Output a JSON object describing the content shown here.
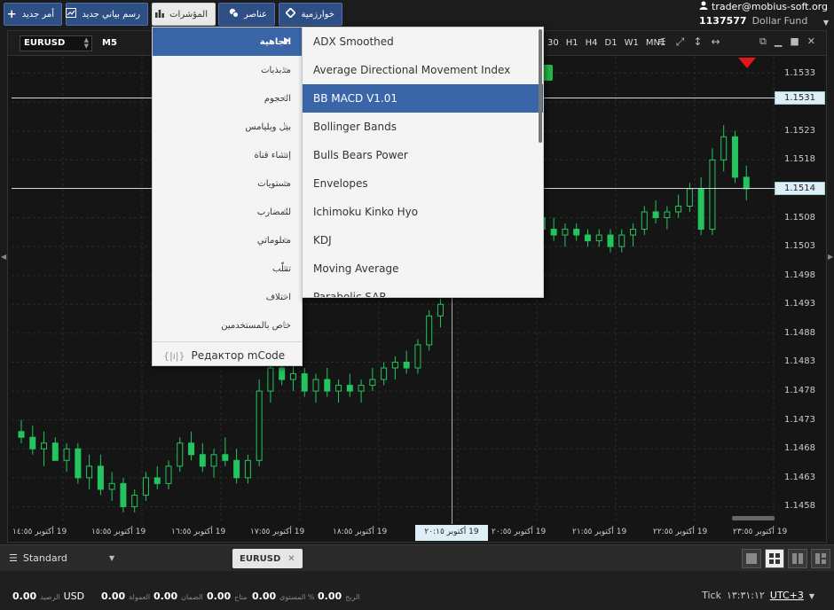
{
  "toolbar": {
    "new_order": "أمر جديد",
    "new_chart": "رسم بياني جديد",
    "indicators": "المؤشرات",
    "elements": "عناصر",
    "algorithms": "خوارزمية"
  },
  "account": {
    "email": "trader@mobius-soft.org",
    "number": "1137577",
    "name": "Dollar Fund"
  },
  "chart": {
    "symbol": "EURUSD",
    "timeframe": "M5",
    "timeframes": [
      "30",
      "H1",
      "H4",
      "D1",
      "W1",
      "MN1"
    ],
    "y_tags": [
      "1.1531",
      "1.1514"
    ],
    "x_crosshair_label": "19 أكتوبر ٢٠:١٥"
  },
  "menu_categories": [
    {
      "label": "اتجاهية",
      "selected": true
    },
    {
      "label": "مذبذبات"
    },
    {
      "label": "الحجوم"
    },
    {
      "label": "بيل ويليامس"
    },
    {
      "label": "إنشاء قناة"
    },
    {
      "label": "مستويات"
    },
    {
      "label": "للمضارب"
    },
    {
      "label": "معلوماتي"
    },
    {
      "label": "تقلّب"
    },
    {
      "label": "اختلاف"
    },
    {
      "label": "خاص بالمستخدمين"
    }
  ],
  "menu_mcode": "Редактор mCode",
  "menu_indicators": [
    {
      "label": "ADX Smoothed"
    },
    {
      "label": "Average Directional Movement Index"
    },
    {
      "label": "BB MACD V1.01",
      "selected": true
    },
    {
      "label": "Bollinger Bands"
    },
    {
      "label": "Bulls Bears Power"
    },
    {
      "label": "Envelopes"
    },
    {
      "label": "Ichimoku Kinko Hyo"
    },
    {
      "label": "KDJ"
    },
    {
      "label": "Moving Average"
    },
    {
      "label": "Parabolic SAR"
    }
  ],
  "bottom": {
    "workspace": "Standard",
    "symbol_tab": "EURUSD"
  },
  "status": {
    "balance_value": "0.00",
    "balance_label": "الرصيد",
    "currency": "USD",
    "commission_value": "0.00",
    "commission_label": "العمولة",
    "margin_value": "0.00",
    "margin_label": "الضمان",
    "free_value": "0.00",
    "free_label": "متاح",
    "level_value": "0.00",
    "level_label": "المستوى %",
    "profit_value": "0.00",
    "profit_label": "الربح",
    "tick_label": "Tick",
    "time": "١٣:٣١:١٢",
    "timezone": "UTC+3"
  },
  "chart_data": {
    "type": "candlestick",
    "x_ticks": [
      "19 أكتوبر ١٤:٥٥",
      "19 أكتوبر ١٥:٥٥",
      "19 أكتوبر ١٦:٥٥",
      "19 أكتوبر ١٧:٥٥",
      "19 أكتوبر ١٨:٥٥",
      "19 أكتوبر ٢٠:٥٥",
      "19 أكتوبر ٢١:٥٥",
      "19 أكتوبر ٢٢:٥٥",
      "19 أكتوبر ٢٣:٥٥"
    ],
    "y_ticks": [
      "1.1533",
      "1.1528",
      "1.1523",
      "1.1518",
      "1.1513",
      "1.1508",
      "1.1503",
      "1.1498",
      "1.1493",
      "1.1488",
      "1.1483",
      "1.1478",
      "1.1473",
      "1.1468",
      "1.1463",
      "1.1458"
    ],
    "ylim": [
      1.1455,
      1.1536
    ],
    "candles": [
      [
        1.1471,
        1.1473,
        1.1469,
        1.147
      ],
      [
        1.147,
        1.1472,
        1.1467,
        1.1468
      ],
      [
        1.1468,
        1.1471,
        1.1465,
        1.1469
      ],
      [
        1.1469,
        1.147,
        1.1466,
        1.1466
      ],
      [
        1.1466,
        1.1469,
        1.1464,
        1.1468
      ],
      [
        1.1468,
        1.1469,
        1.1462,
        1.1463
      ],
      [
        1.1463,
        1.1467,
        1.1461,
        1.1465
      ],
      [
        1.1465,
        1.1467,
        1.146,
        1.1461
      ],
      [
        1.1461,
        1.1464,
        1.1459,
        1.1462
      ],
      [
        1.1462,
        1.1463,
        1.1457,
        1.1458
      ],
      [
        1.1458,
        1.1461,
        1.1457,
        1.146
      ],
      [
        1.146,
        1.1464,
        1.1459,
        1.1463
      ],
      [
        1.1463,
        1.1465,
        1.1461,
        1.1462
      ],
      [
        1.1462,
        1.1466,
        1.1461,
        1.1465
      ],
      [
        1.1465,
        1.147,
        1.1464,
        1.1469
      ],
      [
        1.1469,
        1.1471,
        1.1466,
        1.1467
      ],
      [
        1.1467,
        1.1469,
        1.1464,
        1.1465
      ],
      [
        1.1465,
        1.1468,
        1.1463,
        1.1467
      ],
      [
        1.1467,
        1.147,
        1.1465,
        1.1466
      ],
      [
        1.1466,
        1.1468,
        1.1462,
        1.1463
      ],
      [
        1.1463,
        1.1467,
        1.1462,
        1.1466
      ],
      [
        1.1466,
        1.148,
        1.1465,
        1.1478
      ],
      [
        1.1478,
        1.1484,
        1.1476,
        1.1482
      ],
      [
        1.1482,
        1.1485,
        1.1479,
        1.148
      ],
      [
        1.148,
        1.1483,
        1.1478,
        1.1481
      ],
      [
        1.1481,
        1.1482,
        1.1477,
        1.1478
      ],
      [
        1.1478,
        1.1481,
        1.1476,
        1.148
      ],
      [
        1.148,
        1.1482,
        1.1477,
        1.1478
      ],
      [
        1.1478,
        1.148,
        1.1476,
        1.1479
      ],
      [
        1.1479,
        1.1481,
        1.1477,
        1.1478
      ],
      [
        1.1478,
        1.148,
        1.1476,
        1.1479
      ],
      [
        1.1479,
        1.1482,
        1.1478,
        1.148
      ],
      [
        1.148,
        1.1483,
        1.1479,
        1.1482
      ],
      [
        1.1482,
        1.1484,
        1.148,
        1.1483
      ],
      [
        1.1483,
        1.1485,
        1.1481,
        1.1482
      ],
      [
        1.1482,
        1.1487,
        1.1481,
        1.1486
      ],
      [
        1.1486,
        1.1492,
        1.1485,
        1.1491
      ],
      [
        1.1491,
        1.1494,
        1.1489,
        1.1493
      ],
      [
        1.1513,
        1.1516,
        1.1511,
        1.1512
      ],
      [
        1.1512,
        1.1514,
        1.1508,
        1.1509
      ],
      [
        1.1509,
        1.1511,
        1.1507,
        1.151
      ],
      [
        1.151,
        1.1512,
        1.1508,
        1.1509
      ],
      [
        1.1509,
        1.151,
        1.1506,
        1.1507
      ],
      [
        1.1507,
        1.1509,
        1.1505,
        1.1508
      ],
      [
        1.1508,
        1.151,
        1.1506,
        1.1509
      ],
      [
        1.1509,
        1.151,
        1.1507,
        1.1508
      ],
      [
        1.1508,
        1.1509,
        1.1505,
        1.1506
      ],
      [
        1.1506,
        1.1508,
        1.1504,
        1.1505
      ],
      [
        1.1505,
        1.1507,
        1.1503,
        1.1506
      ],
      [
        1.1506,
        1.1507,
        1.1504,
        1.1505
      ],
      [
        1.1505,
        1.1506,
        1.1503,
        1.1504
      ],
      [
        1.1504,
        1.1506,
        1.1503,
        1.1505
      ],
      [
        1.1505,
        1.1506,
        1.1502,
        1.1503
      ],
      [
        1.1503,
        1.1506,
        1.1502,
        1.1505
      ],
      [
        1.1505,
        1.1507,
        1.1503,
        1.1506
      ],
      [
        1.1506,
        1.151,
        1.1505,
        1.1509
      ],
      [
        1.1509,
        1.1511,
        1.1507,
        1.1508
      ],
      [
        1.1508,
        1.151,
        1.1506,
        1.1509
      ],
      [
        1.1509,
        1.1512,
        1.1508,
        1.151
      ],
      [
        1.151,
        1.1514,
        1.1509,
        1.1513
      ],
      [
        1.1513,
        1.1515,
        1.1505,
        1.1506
      ],
      [
        1.1506,
        1.152,
        1.1505,
        1.1518
      ],
      [
        1.1518,
        1.1524,
        1.1516,
        1.1522
      ],
      [
        1.1522,
        1.1523,
        1.1514,
        1.1515
      ],
      [
        1.1515,
        1.1517,
        1.1511,
        1.1513
      ]
    ]
  }
}
